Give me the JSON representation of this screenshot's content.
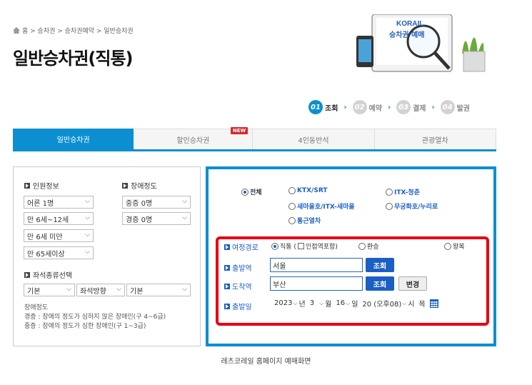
{
  "breadcrumb": {
    "text": "홈 > 승차권 > 승차권예약 > 일반승차권"
  },
  "page_title": "일반승차권(직통)",
  "hero": {
    "logo_text": "KORAIL",
    "caption": "승차권 예매"
  },
  "steps": [
    {
      "num": "01",
      "label": "조회"
    },
    {
      "num": "02",
      "label": "예약"
    },
    {
      "num": "03",
      "label": "결제"
    },
    {
      "num": "04",
      "label": "발권"
    }
  ],
  "step_arrow": "›",
  "tabs": [
    {
      "label": "일반승차권"
    },
    {
      "label": "할인승차권",
      "badge": "NEW"
    },
    {
      "label": "4인동반석"
    },
    {
      "label": "관광열차"
    }
  ],
  "left": {
    "passenger_title": "인원정보",
    "disability_title": "장애정도",
    "adult": "어른 1명",
    "child": "만 6세~12세",
    "infant": "만 6세 미만",
    "senior": "만 65세이상",
    "severe": "중증 0명",
    "mild": "경증 0명",
    "seat_title": "좌석종류선택",
    "seat1": "기본",
    "seat2": "좌석방향",
    "seat3": "기본",
    "info_title": "장애정도",
    "info_line1": "경증 : 장애의 정도가 심하지 않은 장애인(구 4~6급)",
    "info_line2": "중증 : 장애의 정도가 심한 장애인(구 1~3급)"
  },
  "right": {
    "train_types": [
      "전체",
      "KTX/SRT",
      "ITX-청춘",
      "새마을호/ITX-새마을",
      "무궁화호/누리로",
      "통근열차"
    ],
    "route_label": "여정경로",
    "route_direct": "직통 (",
    "route_nearby": "인접역포함)",
    "route_transfer": "환승",
    "route_round": "왕복",
    "departure_label": "출발역",
    "departure_value": "서울",
    "arrival_label": "도착역",
    "arrival_value": "부산",
    "search_label": "조회",
    "change_label": "변경",
    "date_label": "출발일",
    "year": "2023",
    "year_unit": "년",
    "month": "3",
    "month_unit": "월",
    "day": "16",
    "day_unit": "일",
    "hour": "20 (오후08)",
    "hour_unit": "시",
    "weekday": "목"
  },
  "caption": "레츠코레일 홈페이지 예매화면",
  "colors": {
    "accent": "#0c8fd0",
    "highlight": "#e60012",
    "link": "#1c5fc4"
  }
}
